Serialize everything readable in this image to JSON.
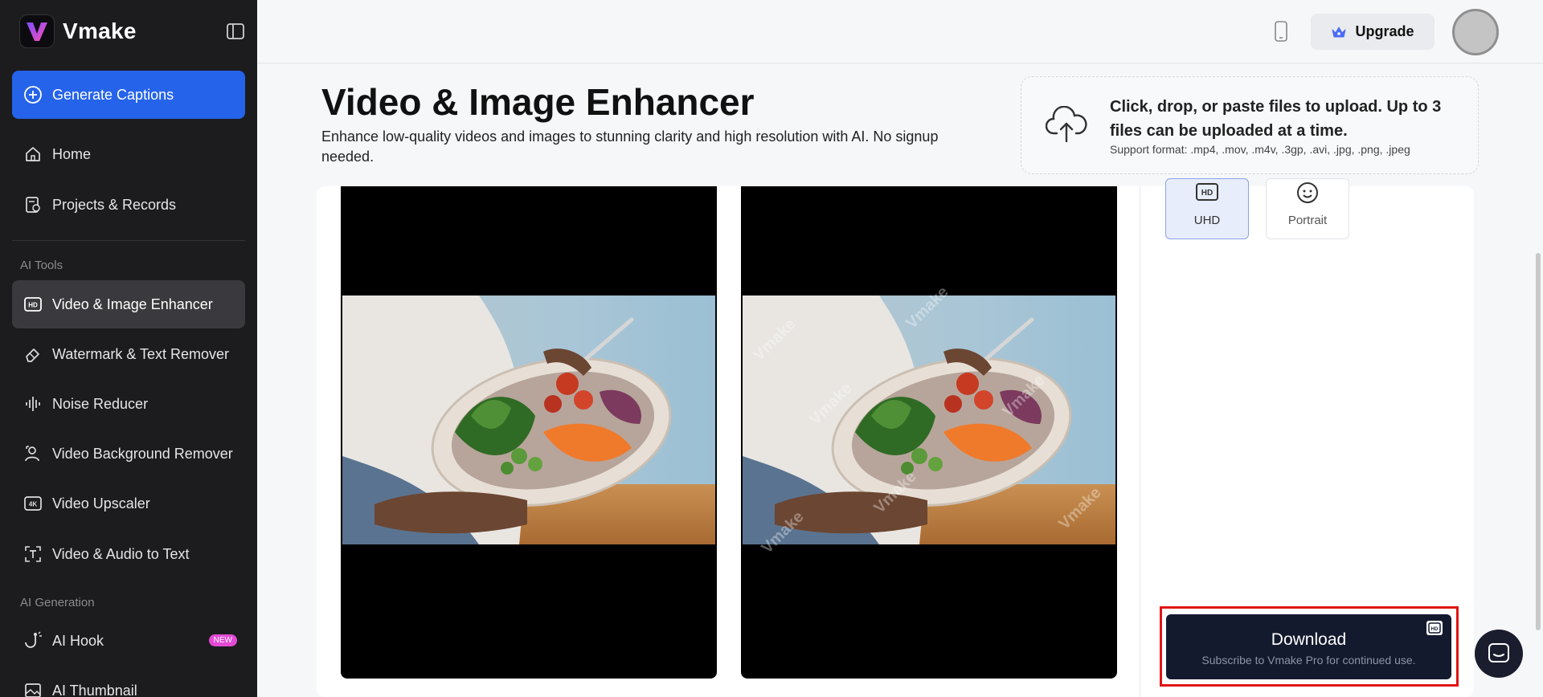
{
  "app": {
    "name": "Vmake"
  },
  "sidebar": {
    "generate_label": "Generate Captions",
    "top_items": [
      {
        "label": "Home",
        "icon": "home-icon"
      },
      {
        "label": "Projects & Records",
        "icon": "projects-icon"
      }
    ],
    "sections": [
      {
        "title": "AI Tools",
        "items": [
          {
            "label": "Video & Image Enhancer",
            "icon": "hd-icon",
            "active": true
          },
          {
            "label": "Watermark & Text Remover",
            "icon": "eraser-icon"
          },
          {
            "label": "Noise Reducer",
            "icon": "waveform-icon"
          },
          {
            "label": "Video Background Remover",
            "icon": "person-bg-icon"
          },
          {
            "label": "Video Upscaler",
            "icon": "4k-icon"
          },
          {
            "label": "Video & Audio to Text",
            "icon": "text-frame-icon"
          }
        ]
      },
      {
        "title": "AI Generation",
        "items": [
          {
            "label": "AI Hook",
            "icon": "hook-icon",
            "badge": "NEW"
          },
          {
            "label": "AI Thumbnail",
            "icon": "thumbnail-icon"
          }
        ]
      }
    ]
  },
  "header": {
    "upgrade_label": "Upgrade"
  },
  "main": {
    "title": "Video & Image Enhancer",
    "subtitle": "Enhance low-quality videos and images to stunning clarity and high resolution with AI. No signup needed.",
    "upload": {
      "main_text": "Click, drop, or paste files to upload. Up to 3 files can be uploaded at a time.",
      "formats": "Support format: .mp4, .mov, .m4v, .3gp, .avi, .jpg, .png, .jpeg"
    },
    "watermark_text": "Vmake",
    "modes": [
      {
        "label": "UHD",
        "icon": "hd-icon",
        "selected": true
      },
      {
        "label": "Portrait",
        "icon": "smile-icon",
        "selected": false
      }
    ],
    "download": {
      "label": "Download",
      "sub": "Subscribe to Vmake Pro for continued use."
    }
  },
  "colors": {
    "sidebar_bg": "#1c1c1e",
    "accent": "#2563eb",
    "download_bg": "#141a2e",
    "highlight": "#e21414",
    "new_badge": "#e24ad4"
  }
}
